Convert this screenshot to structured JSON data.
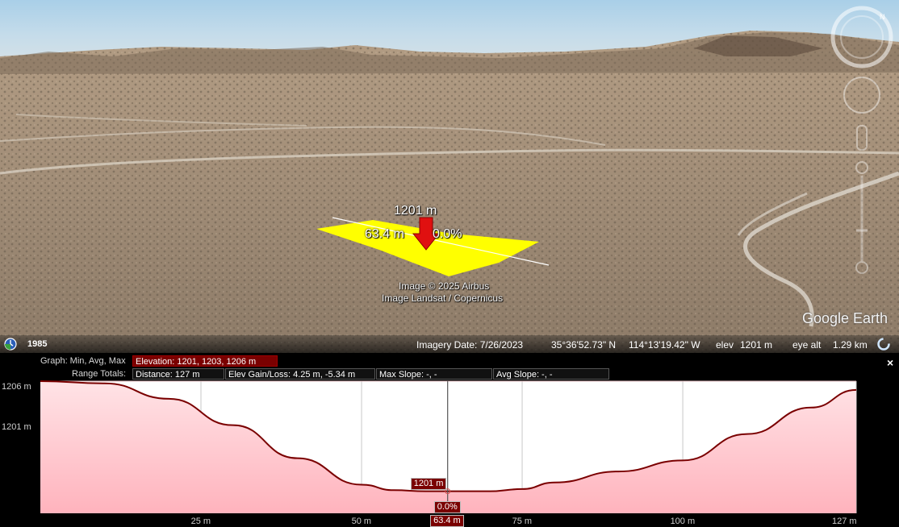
{
  "viewport": {
    "measurement": {
      "elevation": "1201 m",
      "distance": "63.4 m",
      "slope": "0.0%"
    },
    "copyright": [
      "Image © 2025 Airbus",
      "Image Landsat / Copernicus"
    ],
    "logo": "Google Earth",
    "status_bar": {
      "historical_year": "1985",
      "imagery_date": "Imagery Date: 7/26/2023",
      "lat": "35°36'52.73\" N",
      "lon": "114°13'19.42\" W",
      "elev_label": "elev",
      "elev_value": "1201 m",
      "eye_alt_label": "eye alt",
      "eye_alt_value": "1.29 km"
    },
    "icons": {
      "historical": "clock-icon",
      "compass": "compass-icon",
      "look": "look-joystick-icon",
      "move": "move-joystick-icon",
      "street_view": "pegman-icon",
      "zoom": "zoom-slider-icon",
      "streaming": "streaming-icon",
      "close": "close-icon"
    }
  },
  "profile": {
    "graph_label": "Graph: Min, Avg, Max",
    "elevation_stats": "Elevation: 1201, 1203, 1206 m",
    "range_label": "Range Totals:",
    "distance": "Distance: 127 m",
    "elev_gain_loss": "Elev Gain/Loss: 4.25 m, -5.34 m",
    "max_slope": "Max Slope: -, -",
    "avg_slope": "Avg Slope: -, -",
    "close_label": "×",
    "y_ticks": [
      "1206 m",
      "1201 m"
    ],
    "x_ticks": [
      "25 m",
      "50 m",
      "63.4 m",
      "75 m",
      "100 m",
      "127 m"
    ],
    "cursor_elev": "1201 m",
    "cursor_slope": "0.0%"
  },
  "chart_data": {
    "type": "area",
    "x": [
      0,
      10,
      20,
      30,
      40,
      50,
      55,
      60,
      65,
      70,
      75,
      80,
      90,
      100,
      110,
      120,
      127
    ],
    "y": [
      1206.0,
      1205.9,
      1205.2,
      1204.0,
      1202.5,
      1201.3,
      1201.05,
      1201.0,
      1201.0,
      1201.0,
      1201.1,
      1201.4,
      1201.9,
      1202.4,
      1203.6,
      1204.8,
      1205.6
    ],
    "xlim": [
      0,
      127
    ],
    "ylim": [
      1200,
      1206
    ],
    "cursor_x": 63.4,
    "colors": {
      "line": "#7a0000",
      "fill_top": "#ffe3e6",
      "fill_bottom": "#ffb3bd",
      "accent": "#7a0000"
    }
  }
}
